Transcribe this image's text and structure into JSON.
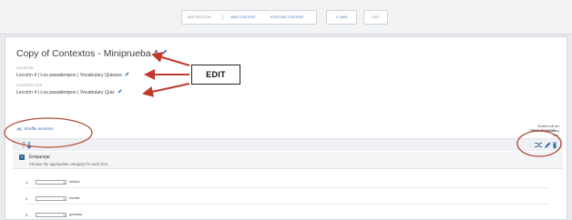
{
  "toolbar": {
    "add_section": "ADD SECTION",
    "new_content": "NEW CONTENT",
    "existing_content": "EXISTING CONTENT",
    "save": "SAVE",
    "exit": "EXIT"
  },
  "assessment": {
    "title": "Copy of Contextos - Miniprueba A",
    "location_label": "LOCATION",
    "location_value": "Lección 4 | Los pasatiempos | Vocabulary Quizzes",
    "students_label": "STUDENTS SEE",
    "students_value": "Lección 4 | Los pasatiempos | Vocabulary Quiz",
    "note": "Students will see administrative setting here.",
    "total": "Total: 40 points"
  },
  "annotation": {
    "edit_label": "EDIT"
  },
  "section": {
    "shuffle_label": "Shuffle sections"
  },
  "question": {
    "number": "1",
    "title": "Emparejar",
    "instructions": "Choose the appropriate category for each item."
  },
  "items": [
    {
      "num": "1.",
      "word": "béisbol"
    },
    {
      "num": "2.",
      "word": "escribir"
    },
    {
      "num": "3.",
      "word": "gimnasio"
    }
  ],
  "colors": {
    "accent": "#3d6fb0",
    "annotation_red": "#c0392b",
    "question_badge": "#2f5d94"
  }
}
